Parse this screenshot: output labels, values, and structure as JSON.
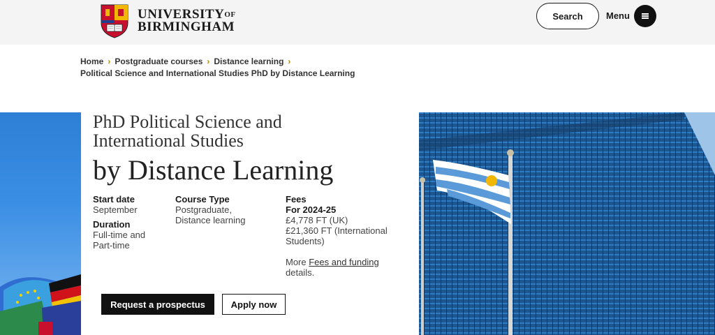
{
  "header": {
    "logo_line1": "UNIVERSITY",
    "logo_of": "OF",
    "logo_line2": "BIRMINGHAM",
    "search_label": "Search",
    "menu_label": "Menu"
  },
  "breadcrumb": {
    "items": [
      "Home",
      "Postgraduate courses",
      "Distance learning"
    ],
    "current": "Political Science and International Studies PhD by Distance Learning"
  },
  "course": {
    "title_line1": "PhD Political Science and",
    "title_line2": "International Studies",
    "title_line3": "by Distance Learning",
    "start_date_label": "Start date",
    "start_date_value": "September",
    "duration_label": "Duration",
    "duration_value_1": "Full-time and",
    "duration_value_2": "Part-time",
    "course_type_label": "Course Type",
    "course_type_value_1": "Postgraduate,",
    "course_type_value_2": "Distance learning",
    "fees_label": "Fees",
    "fees_year": "For 2024-25",
    "fees_uk": "£4,778 FT (UK)",
    "fees_intl_1": "£21,360 FT (International",
    "fees_intl_2": "Students)",
    "more_prefix": "More ",
    "more_link": "Fees and funding",
    "more_suffix": "details."
  },
  "actions": {
    "prospectus_label": "Request a prospectus",
    "apply_label": "Apply now"
  },
  "colors": {
    "accent_chevron": "#b28a00",
    "button_dark": "#111111",
    "header_bg": "#f4f4f4"
  }
}
